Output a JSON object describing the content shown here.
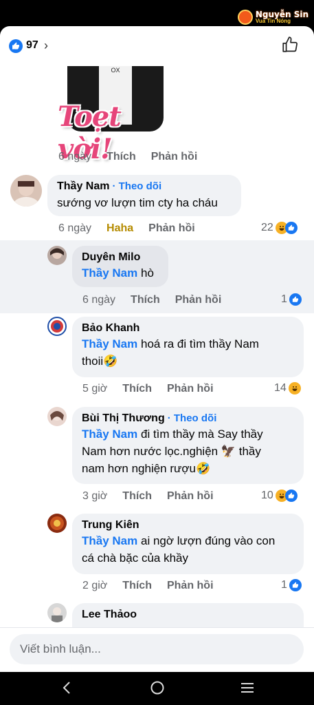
{
  "watermark": {
    "name": "Nguyễn Sin",
    "tagline": "Vua Tin Nóng"
  },
  "reactions": {
    "count": "97",
    "chevron": "›"
  },
  "sticker": {
    "caption": "Toẹt vời!",
    "shirt_text": "OX"
  },
  "post_meta": {
    "time": "6 ngày",
    "like": "Thích",
    "reply": "Phản hồi"
  },
  "comments": [
    {
      "name": "Thầy Nam",
      "follow": "· Theo dõi",
      "text": "sướng vơ lượn tim cty ha cháu",
      "time": "6 ngày",
      "reaction_label": "Haha",
      "reply": "Phản hồi",
      "count": "22"
    },
    {
      "name": "Duyên Milo",
      "mention": "Thầy Nam",
      "text": "hò",
      "time": "6 ngày",
      "like": "Thích",
      "reply": "Phản hồi",
      "count": "1"
    },
    {
      "name": "Bảo Khanh",
      "mention": "Thầy Nam",
      "text": "hoá ra đi tìm thầy Nam",
      "text2": "thoii🤣",
      "time": "5 giờ",
      "like": "Thích",
      "reply": "Phản hồi",
      "count": "14"
    },
    {
      "name": "Bùi Thị Thương",
      "follow": "· Theo dõi",
      "mention": "Thầy Nam",
      "text": "đi tìm thầy mà Say thầy",
      "text2": "Nam hơn nước lọc.nghiện 🦅 thầy",
      "text3": "nam hơn nghiện rượu🤣",
      "time": "3 giờ",
      "like": "Thích",
      "reply": "Phản hồi",
      "count": "10"
    },
    {
      "name": "Trung Kiên",
      "mention": "Thầy Nam",
      "text": "ai ngờ lượn đúng vào con",
      "text2": "cá chà bặc của khầy",
      "time": "2 giờ",
      "like": "Thích",
      "reply": "Phản hồi",
      "count": "1"
    },
    {
      "name": "Lee Thảoo"
    }
  ],
  "composer": {
    "placeholder": "Viết bình luận..."
  },
  "colors": {
    "accent": "#1877f2",
    "haha": "#f7b125",
    "bubble": "#f0f2f5"
  }
}
